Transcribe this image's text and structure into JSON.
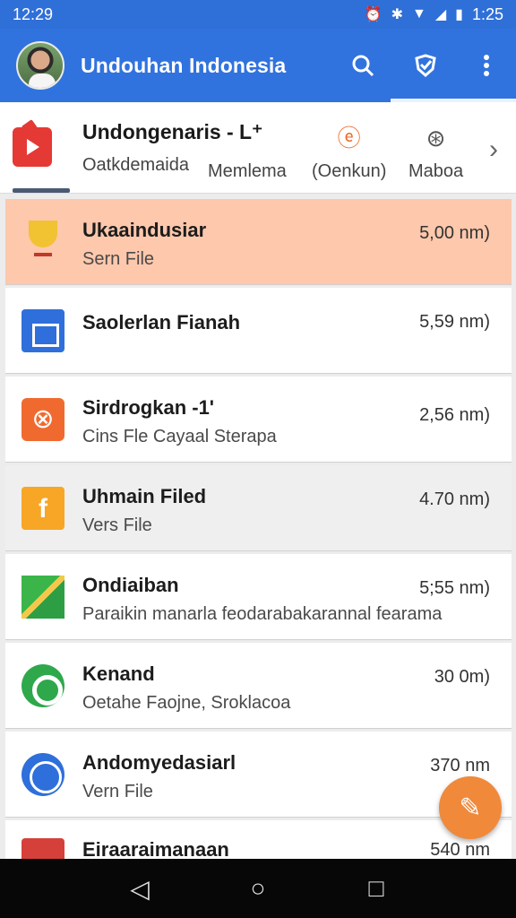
{
  "status_bar": {
    "time": "12:29",
    "icons": [
      "alarm-icon",
      "bluetooth-icon",
      "wifi-icon",
      "signal-icon",
      "battery-icon"
    ],
    "right_time": "1:25"
  },
  "app_bar": {
    "title": "Undouhan Indonesia",
    "actions": [
      "search-icon",
      "shield-check-icon",
      "more-vert-icon"
    ],
    "color": "#3173de"
  },
  "categories": {
    "first_title": "Undongenaris - L⁺",
    "items": [
      "Oatkdemaida",
      "Memlema",
      "(Oenkun)",
      "Maboa"
    ]
  },
  "files": [
    {
      "name": "Ukaaindusiar",
      "desc": "Sern File",
      "size": "5,00 nm)",
      "icon": "trophy-icon",
      "state": "highlight"
    },
    {
      "name": "Saolerlan Fianah",
      "desc": "",
      "size": "5,59 nm)",
      "icon": "blue-folder-icon",
      "state": "normal"
    },
    {
      "name": "Sirdrogkan -1'",
      "desc": "Cins Fle Cayaal Sterapa",
      "size": "2,56 nm)",
      "icon": "orange-camera-icon",
      "state": "normal"
    },
    {
      "name": "Uhmain Filed",
      "desc": "Vers File",
      "size": "4.70 nm)",
      "icon": "yellow-folder-icon",
      "state": "selected"
    },
    {
      "name": "Ondiaiban",
      "desc": "Paraikin manarla feodarabakarannal fearama",
      "size": "5;55 nm)",
      "icon": "green-map-icon",
      "state": "normal"
    },
    {
      "name": "Kenand",
      "desc": "Oetahe Faojne, Sroklacoa",
      "size": "30 0m)",
      "icon": "green-circle-icon",
      "state": "normal"
    },
    {
      "name": "Andomyedasiarl",
      "desc": "Vern File",
      "size": "370 nm",
      "icon": "blue-circle-icon",
      "state": "normal"
    },
    {
      "name": "Eiraaraimanaan",
      "desc": "",
      "size": "540 nm",
      "icon": "red-folder-icon",
      "state": "partial"
    }
  ],
  "fab": {
    "icon": "edit-icon",
    "color": "#f0893a"
  },
  "nav": [
    "back-icon",
    "home-icon",
    "recents-icon"
  ]
}
